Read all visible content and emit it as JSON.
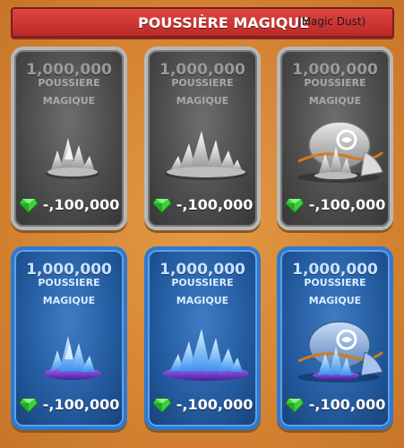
{
  "banner": {
    "title": "POUSSIÈRE MAGIQUE",
    "subtitle": "(Magic Dust)"
  },
  "colors": {
    "background": "#d98a34",
    "banner": "#c93331",
    "gray_card_border": "#b8b8b8",
    "blue_card_border": "#2f79d0",
    "gem": "#3bd23b"
  },
  "cards": [
    {
      "amount": "1,000,000",
      "label1": "POUSSIERE",
      "label2": "MAGIQUE",
      "price": "-,100,000",
      "style": "gray",
      "icon": "silver-dust-small-icon"
    },
    {
      "amount": "1,000,000",
      "label1": "POUSSIERE",
      "label2": "MAGIQUE",
      "price": "-,100,000",
      "style": "gray",
      "icon": "silver-dust-pile-icon"
    },
    {
      "amount": "1,000,000",
      "label1": "POUSSIERE",
      "label2": "MAGIQUE",
      "price": "-,100,000",
      "style": "gray",
      "icon": "silver-dust-bag-icon"
    },
    {
      "amount": "1,000,000",
      "label1": "POUSSIERE",
      "label2": "MAGIQUE",
      "price": "-,100,000",
      "style": "blue",
      "icon": "blue-dust-small-icon"
    },
    {
      "amount": "1,000,000",
      "label1": "POUSSIERE",
      "label2": "MAGIQUE",
      "price": "-,100,000",
      "style": "blue",
      "icon": "blue-dust-pile-icon"
    },
    {
      "amount": "1,000,000",
      "label1": "POUSSIERE",
      "label2": "MAGIQUE",
      "price": "-,100,000",
      "style": "blue",
      "icon": "blue-dust-bag-icon"
    }
  ]
}
